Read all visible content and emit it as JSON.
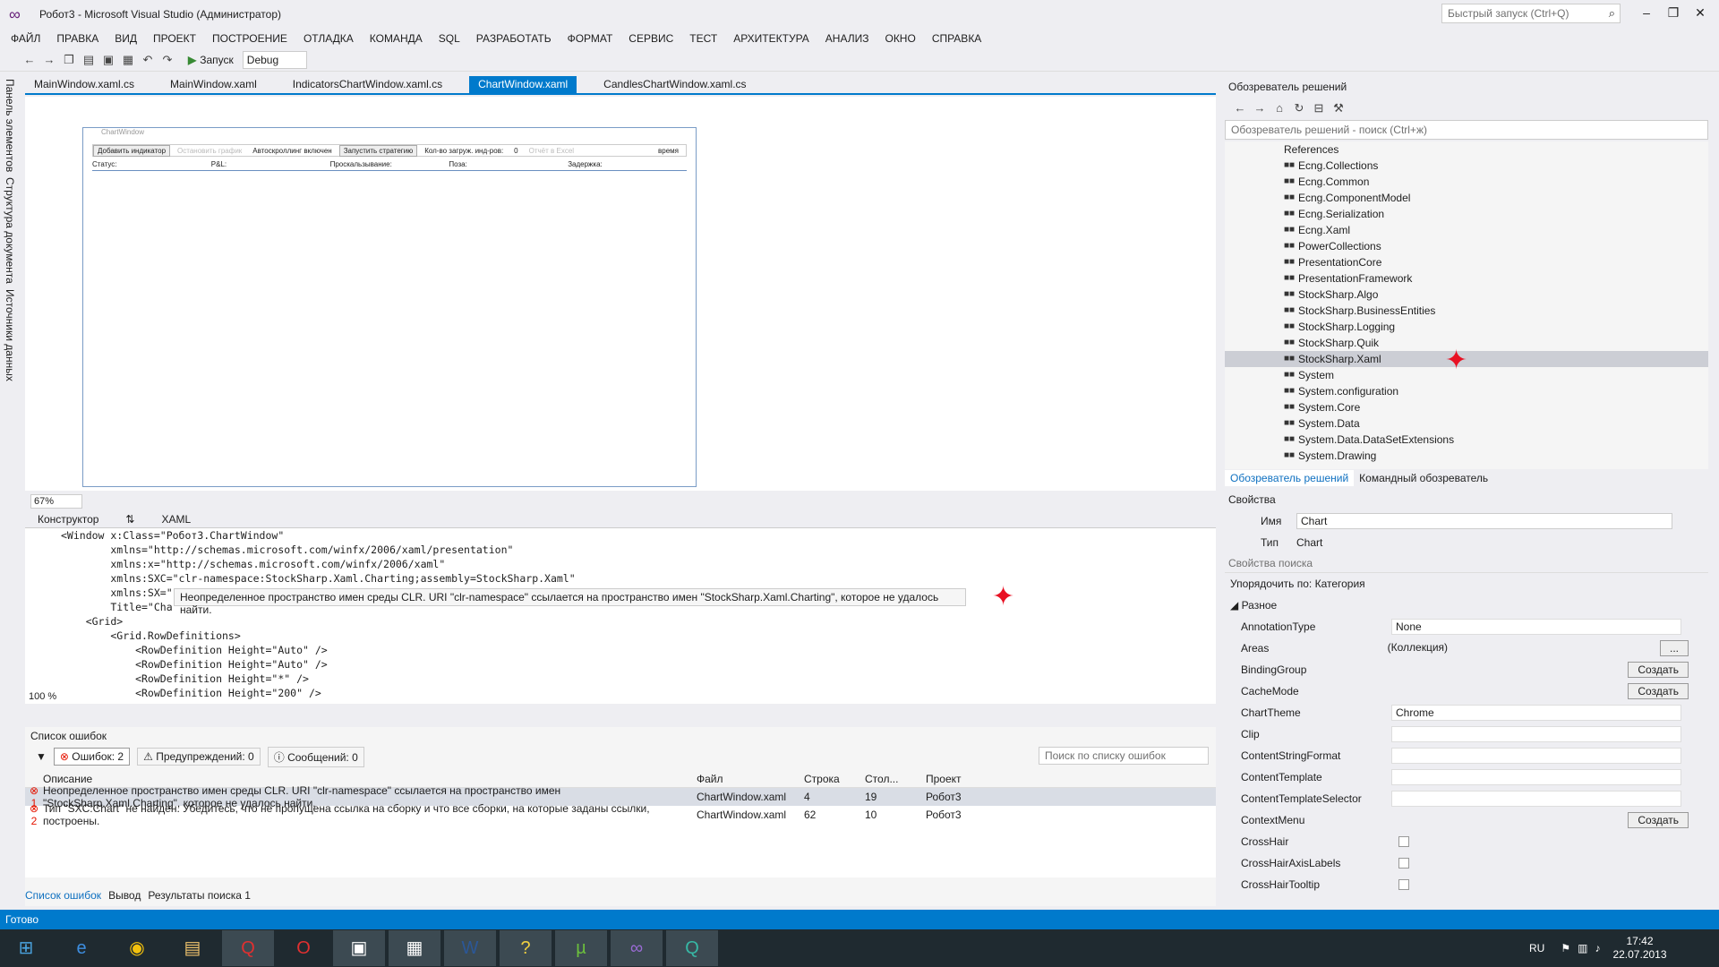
{
  "window": {
    "title": "Робот3 - Microsoft Visual Studio (Администратор)",
    "quick_launch": "Быстрый запуск (Ctrl+Q)"
  },
  "menu": [
    "ФАЙЛ",
    "ПРАВКА",
    "ВИД",
    "ПРОЕКТ",
    "ПОСТРОЕНИЕ",
    "ОТЛАДКА",
    "КОМАНДА",
    "SQL",
    "РАЗРАБОТАТЬ",
    "ФОРМАТ",
    "СЕРВИС",
    "ТЕСТ",
    "АРХИТЕКТУРА",
    "АНАЛИЗ",
    "ОКНО",
    "СПРАВКА"
  ],
  "toolbar": {
    "run_label": "Запуск",
    "config": "Debug"
  },
  "left_tabs": [
    "Панель элементов",
    "Структура документа",
    "Источники данных"
  ],
  "doc_tabs": [
    "MainWindow.xaml.cs",
    "MainWindow.xaml",
    "IndicatorsChartWindow.xaml.cs",
    "ChartWindow.xaml",
    "CandlesChartWindow.xaml.cs"
  ],
  "active_tab": "ChartWindow.xaml",
  "designer": {
    "window_title": "ChartWindow",
    "buttons": [
      "Добавить индикатор",
      "Остановить график",
      "Автоскроллинг включен",
      "Запустить стратегию",
      "Кол-во загруж. инд-ров:",
      "0",
      "Отчёт в Excel",
      "время"
    ],
    "status": [
      "Статус:",
      "P&L:",
      "Проскальзывание:",
      "Поза:",
      "Задержка:"
    ],
    "zoom": "67%"
  },
  "split": {
    "designer": "Конструктор",
    "xaml": "XAML"
  },
  "code": {
    "lines": [
      "<Window x:Class=\"Робот3.ChartWindow\"",
      "        xmlns=\"http://schemas.microsoft.com/winfx/2006/xaml/presentation\"",
      "        xmlns:x=\"http://schemas.microsoft.com/winfx/2006/xaml\"",
      "        xmlns:SXC=\"clr-namespace:StockSharp.Xaml.Charting;assembly=StockSharp.Xaml\"",
      "        xmlns:SX=\"",
      "        Title=\"Cha",
      "    <Grid>",
      "        <Grid.RowDefinitions>",
      "            <RowDefinition Height=\"Auto\" />",
      "            <RowDefinition Height=\"Auto\" />",
      "            <RowDefinition Height=\"*\" />",
      "            <RowDefinition Height=\"200\" />"
    ],
    "zoom": "100 %",
    "tooltip": "Неопределенное пространство имен среды CLR. URI \"clr-namespace\" ссылается на пространство имен \"StockSharp.Xaml.Charting\", которое не удалось найти."
  },
  "errors": {
    "title": "Список ошибок",
    "errors_label": "Ошибок: 2",
    "warnings_label": "Предупреждений: 0",
    "messages_label": "Сообщений: 0",
    "search_placeholder": "Поиск по списку ошибок",
    "headers": [
      "Описание",
      "Файл",
      "Строка",
      "Стол...",
      "Проект"
    ],
    "rows": [
      {
        "n": "1",
        "desc": "Неопределенное пространство имен среды CLR. URI \"clr-namespace\" ссылается на пространство имен \"StockSharp.Xaml.Charting\", которое не удалось найти.",
        "file": "ChartWindow.xaml",
        "line": "4",
        "col": "19",
        "project": "Робот3"
      },
      {
        "n": "2",
        "desc": "Тип \"SXC:Chart\" не найден. Убедитесь, что не пропущена ссылка на сборку и что все сборки, на которые заданы ссылки, построены.",
        "file": "ChartWindow.xaml",
        "line": "62",
        "col": "10",
        "project": "Робот3"
      }
    ]
  },
  "output_tabs": [
    "Список ошибок",
    "Вывод",
    "Результаты поиска 1"
  ],
  "solution": {
    "title": "Обозреватель решений",
    "search": "Обозреватель решений - поиск (Ctrl+ж)",
    "root": "References",
    "items": [
      "Ecng.Collections",
      "Ecng.Common",
      "Ecng.ComponentModel",
      "Ecng.Serialization",
      "Ecng.Xaml",
      "PowerCollections",
      "PresentationCore",
      "PresentationFramework",
      "StockSharp.Algo",
      "StockSharp.BusinessEntities",
      "StockSharp.Logging",
      "StockSharp.Quik",
      "StockSharp.Xaml",
      "System",
      "System.configuration",
      "System.Core",
      "System.Data",
      "System.Data.DataSetExtensions",
      "System.Drawing"
    ],
    "selected": "StockSharp.Xaml",
    "tabs": [
      "Обозреватель решений",
      "Командный обозреватель"
    ]
  },
  "properties": {
    "title": "Свойства",
    "name_label": "Имя",
    "name_value": "Chart",
    "type_label": "Тип",
    "type_value": "Chart",
    "search": "Свойства поиска",
    "sort": "Упорядочить по: Категория",
    "category": "Разное",
    "create_label": "Создать",
    "rows": [
      {
        "name": "AnnotationType",
        "value": "None",
        "kind": "select"
      },
      {
        "name": "Areas",
        "value": "(Коллекция)",
        "kind": "dots"
      },
      {
        "name": "BindingGroup",
        "value": "",
        "kind": "button"
      },
      {
        "name": "CacheMode",
        "value": "",
        "kind": "button"
      },
      {
        "name": "ChartTheme",
        "value": "Chrome",
        "kind": "text"
      },
      {
        "name": "Clip",
        "value": "",
        "kind": "text"
      },
      {
        "name": "ContentStringFormat",
        "value": "",
        "kind": "text"
      },
      {
        "name": "ContentTemplate",
        "value": "",
        "kind": "text"
      },
      {
        "name": "ContentTemplateSelector",
        "value": "",
        "kind": "text"
      },
      {
        "name": "ContextMenu",
        "value": "",
        "kind": "button"
      },
      {
        "name": "CrossHair",
        "value": "",
        "kind": "check"
      },
      {
        "name": "CrossHairAxisLabels",
        "value": "",
        "kind": "check"
      },
      {
        "name": "CrossHairTooltip",
        "value": "",
        "kind": "check"
      }
    ]
  },
  "status": {
    "text": "Готово"
  },
  "tray": {
    "lang": "RU",
    "time": "17:42",
    "date": "22.07.2013"
  }
}
